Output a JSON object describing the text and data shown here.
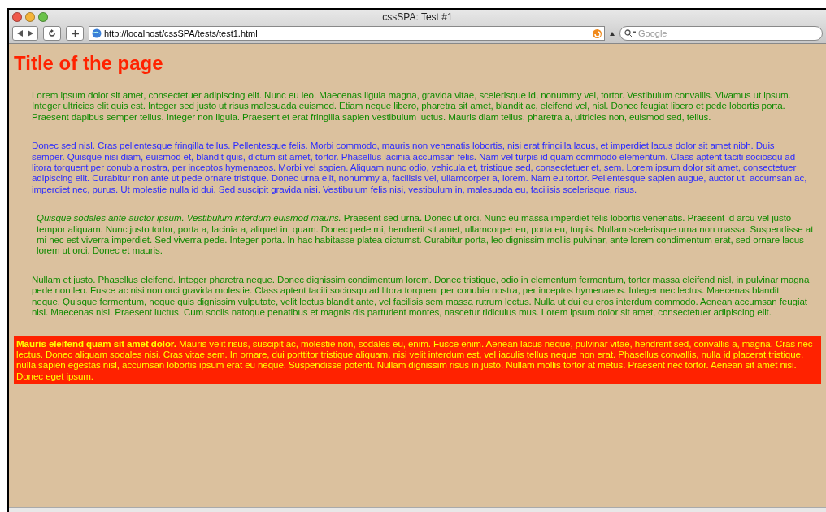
{
  "window": {
    "title": "cssSPA: Test #1"
  },
  "toolbar": {
    "url": "http://localhost/cssSPA/tests/test1.html",
    "search_placeholder": "Google"
  },
  "page": {
    "title": "Title of the page",
    "paragraphs": [
      {
        "kind": "plain",
        "indent": false,
        "color": "#108a00",
        "text": "Lorem ipsum dolor sit amet, consectetuer adipiscing elit. Nunc eu leo. Maecenas ligula magna, gravida vitae, scelerisque id, nonummy vel, tortor. Vestibulum convallis. Vivamus ut ipsum. Integer ultricies elit quis est. Integer sed justo ut risus malesuada euismod. Etiam neque libero, pharetra sit amet, blandit ac, eleifend vel, nisl. Donec feugiat libero et pede lobortis porta. Praesent dapibus semper tellus. Integer non ligula. Praesent et erat fringilla sapien vestibulum luctus. Mauris diam tellus, pharetra a, ultricies non, euismod sed, tellus."
      },
      {
        "kind": "plain",
        "indent": false,
        "color": "#2b2bff",
        "text": "Donec sed nisl. Cras pellentesque fringilla tellus. Pellentesque felis. Morbi commodo, mauris non venenatis lobortis, nisi erat fringilla lacus, et imperdiet lacus dolor sit amet nibh. Duis semper. Quisque nisi diam, euismod et, blandit quis, dictum sit amet, tortor. Phasellus lacinia accumsan felis. Nam vel turpis id quam commodo elementum. Class aptent taciti sociosqu ad litora torquent per conubia nostra, per inceptos hymenaeos. Morbi vel sapien. Aliquam nunc odio, vehicula et, tristique sed, consectetuer et, sem. Lorem ipsum dolor sit amet, consectetuer adipiscing elit. Curabitur non ante ut pede ornare tristique. Donec urna elit, nonummy a, facilisis vel, ullamcorper a, lorem. Nam eu tortor. Pellentesque sapien augue, auctor ut, accumsan ac, imperdiet nec, purus. Ut molestie nulla id dui. Sed suscipit gravida nisi. Vestibulum felis nisi, vestibulum in, malesuada eu, facilisis scelerisque, risus."
      },
      {
        "kind": "plain",
        "indent": true,
        "color": "#108a00",
        "text": "*Quisque sodales ante auctor ipsum. Vestibulum interdum euismod mauris.* Praesent sed urna. Donec ut orci. Nunc eu massa imperdiet felis lobortis venenatis. Praesent id arcu vel justo tempor aliquam. Nunc justo tortor, porta a, lacinia a, aliquet in, quam. Donec pede mi, hendrerit sit amet, ullamcorper eu, porta eu, turpis. Nullam scelerisque urna non massa. Suspendisse at mi nec est viverra imperdiet. Sed viverra pede. Integer porta. In hac habitasse platea dictumst. Curabitur porta, leo dignissim mollis pulvinar, ante lorem condimentum erat, sed ornare lacus lorem ut orci. Donec et mauris."
      },
      {
        "kind": "plain",
        "indent": false,
        "color": "#108a00",
        "text": "Nullam et justo. Phasellus eleifend. Integer pharetra neque. Donec dignissim condimentum lorem. Donec tristique, odio in elementum fermentum, tortor massa eleifend nisl, in pulvinar magna pede non leo. Fusce ac nisi non orci gravida molestie. Class aptent taciti sociosqu ad litora torquent per conubia nostra, per inceptos hymenaeos. Integer nec lectus. Maecenas blandit neque. Quisque fermentum, neque quis dignissim vulputate, velit lectus blandit ante, vel facilisis sem massa rutrum lectus. Nulla ut dui eu eros interdum commodo. Aenean accumsan feugiat nisi. Maecenas nisi. Praesent luctus. Cum sociis natoque penatibus et magnis dis parturient montes, nascetur ridiculus mus. Lorem ipsum dolor sit amet, consectetuer adipiscing elit."
      },
      {
        "kind": "highlight",
        "indent": false,
        "text": "**Mauris eleifend quam sit amet dolor.** Mauris velit risus, suscipit ac, molestie non, sodales eu, enim. Fusce enim. Aenean lacus neque, pulvinar vitae, hendrerit sed, convallis a, magna. Cras nec lectus. Donec aliquam sodales nisi. Cras vitae sem. In ornare, dui porttitor tristique aliquam, nisi velit interdum est, vel iaculis tellus neque non erat. Phasellus convallis, nulla id placerat tristique, nulla sapien egestas nisl, accumsan lobortis ipsum erat eu neque. Suspendisse potenti. Nullam dignissim risus in justo. Nullam mollis tortor at metus. Praesent nec tortor. Aenean sit amet nisi. Donec eget ipsum."
      }
    ]
  }
}
